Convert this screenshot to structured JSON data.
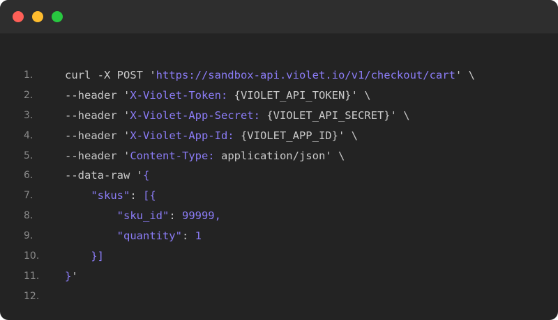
{
  "editor": {
    "lines": [
      {
        "number": "1.",
        "segments": [
          {
            "text": "curl -X POST '",
            "hl": false
          },
          {
            "text": "https://sandbox-api.violet.io/v1/checkout/cart",
            "hl": true
          },
          {
            "text": "' \\",
            "hl": false
          }
        ]
      },
      {
        "number": "2.",
        "segments": [
          {
            "text": "--header '",
            "hl": false
          },
          {
            "text": "X-Violet-Token:",
            "hl": true
          },
          {
            "text": " {VIOLET_API_TOKEN}' \\",
            "hl": false
          }
        ]
      },
      {
        "number": "3.",
        "segments": [
          {
            "text": "--header '",
            "hl": false
          },
          {
            "text": "X-Violet-App-Secret:",
            "hl": true
          },
          {
            "text": " {VIOLET_API_SECRET}' \\",
            "hl": false
          }
        ]
      },
      {
        "number": "4.",
        "segments": [
          {
            "text": "--header '",
            "hl": false
          },
          {
            "text": "X-Violet-App-Id:",
            "hl": true
          },
          {
            "text": " {VIOLET_APP_ID}' \\",
            "hl": false
          }
        ]
      },
      {
        "number": "5.",
        "segments": [
          {
            "text": "--header '",
            "hl": false
          },
          {
            "text": "Content-Type:",
            "hl": true
          },
          {
            "text": " application/json' \\",
            "hl": false
          }
        ]
      },
      {
        "number": "6.",
        "segments": [
          {
            "text": "--data-raw '",
            "hl": false
          },
          {
            "text": "{",
            "hl": true
          }
        ]
      },
      {
        "number": "7.",
        "segments": [
          {
            "text": "    ",
            "hl": false
          },
          {
            "text": "\"skus\"",
            "hl": true
          },
          {
            "text": ": ",
            "hl": false
          },
          {
            "text": "[{",
            "hl": true
          }
        ]
      },
      {
        "number": "8.",
        "segments": [
          {
            "text": "        ",
            "hl": false
          },
          {
            "text": "\"sku_id\"",
            "hl": true
          },
          {
            "text": ": ",
            "hl": false
          },
          {
            "text": "99999,",
            "hl": true
          }
        ]
      },
      {
        "number": "9.",
        "segments": [
          {
            "text": "        ",
            "hl": false
          },
          {
            "text": "\"quantity\"",
            "hl": true
          },
          {
            "text": ": ",
            "hl": false
          },
          {
            "text": "1",
            "hl": true
          }
        ]
      },
      {
        "number": "10.",
        "segments": [
          {
            "text": "    ",
            "hl": false
          },
          {
            "text": "}]",
            "hl": true
          }
        ]
      },
      {
        "number": "11.",
        "segments": [
          {
            "text": "}",
            "hl": true
          },
          {
            "text": "'",
            "hl": false
          }
        ]
      },
      {
        "number": "12.",
        "segments": []
      }
    ]
  },
  "colors": {
    "window_bg": "#232323",
    "titlebar_bg": "#2e2e2e",
    "text": "#c9c9c9",
    "highlight": "#8b7cf6",
    "line_number": "#8a8a8a",
    "close": "#fe5f57",
    "minimize": "#febc2e",
    "zoom": "#28c840"
  }
}
